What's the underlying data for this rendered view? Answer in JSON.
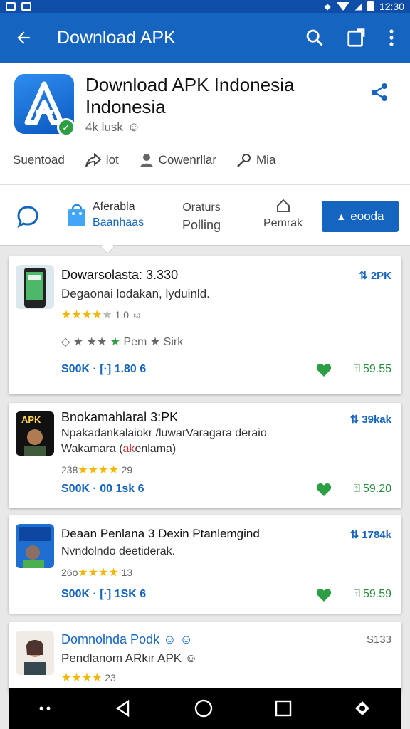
{
  "status_bar": {
    "time": "12:30"
  },
  "app_bar": {
    "title": "Download APK"
  },
  "app": {
    "title": "Download APK Indonesia Indonesia",
    "meta": "4k lusk",
    "actions": [
      "Suentoad",
      "lot",
      "Cowenrllar",
      "Mia"
    ]
  },
  "filters": {
    "category_line1": "Aferabla",
    "category_line2": "Baanhaas",
    "orders_line1": "Oraturs",
    "orders_line2": "Polling",
    "permak": "Pemrak",
    "button_label": "eooda"
  },
  "cards": [
    {
      "title": "Dowarsolasta: 3.330",
      "desc": "Degaonai lodakan, lyduinld.",
      "rating_text": "1.0",
      "secondary_row": "Pem",
      "secondary_row2": "Sirk",
      "link": "S00K · [·] 1.80 6",
      "badge": "2PK",
      "size": "59.55"
    },
    {
      "title": "Bnokamahlaral 3:PK",
      "desc": "Npakadankalaiokr /luwarVaragara deraio",
      "desc2_prefix": "Wakamara (",
      "desc2_highlight": "ak",
      "desc2_suffix": "enlama)",
      "rating_prefix": "238",
      "rating_text": "29",
      "link": "S00K · 00 1sk 6",
      "badge": "39kak",
      "size": "59.20"
    },
    {
      "title": "Deaan Penlana 3 Dexin Ptanlemgind",
      "desc": "Nvndolndo deetiderak.",
      "rating_prefix": "26o",
      "rating_text": "13",
      "link": "S00K · [·] 1SK 6",
      "badge": "1784k",
      "size": "59.59"
    },
    {
      "title": "Domnolnda Podk",
      "desc": "Pendlanom ARkir APK",
      "rating_text": "23",
      "badge": "S133"
    }
  ],
  "colors": {
    "primary": "#1565c0",
    "status_bar": "#0f4ea8",
    "star": "#f2b600",
    "green": "#2e9e44"
  }
}
